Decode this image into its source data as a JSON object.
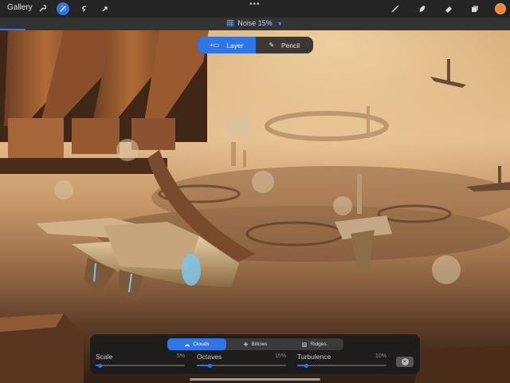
{
  "topbar": {
    "gallery_label": "Gallery",
    "more_glyph": "•••",
    "left_tools": [
      "wrench-icon",
      "magic-wand-icon",
      "selection-icon",
      "transform-arrow-icon"
    ],
    "right_tools": [
      "brush-icon",
      "smudge-icon",
      "eraser-icon",
      "layers-icon"
    ],
    "active_tool": "magic-wand-icon",
    "current_color": "#e88838"
  },
  "adjustment": {
    "name": "Noise",
    "value_text": "15%",
    "level": 0.15
  },
  "mode_toggle": {
    "options": [
      "Layer",
      "Pencil"
    ],
    "selected": "Layer"
  },
  "noise_panel": {
    "tabs": [
      "Clouds",
      "Billows",
      "Ridges"
    ],
    "selected_tab": "Clouds",
    "sliders": [
      {
        "label": "Scale",
        "value_text": "5%",
        "level": 0.05
      },
      {
        "label": "Octaves",
        "value_text": "15%",
        "level": 0.15
      },
      {
        "label": "Turbulence",
        "value_text": "10%",
        "level": 0.1
      }
    ],
    "reset_icon": "reset-icon"
  },
  "colors": {
    "accent": "#2f76e4",
    "toolbar_bg": "#252525",
    "panel_bg": "#1c1c1c"
  }
}
